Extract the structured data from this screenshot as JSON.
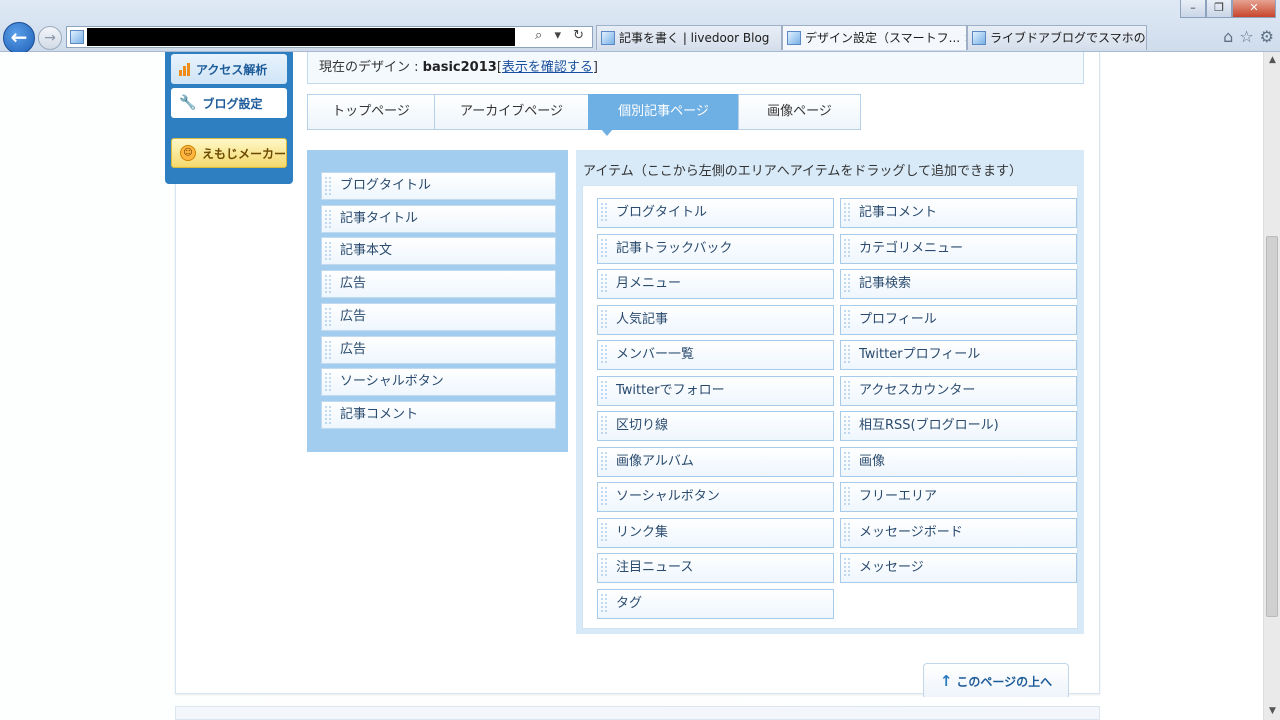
{
  "browser": {
    "tabs": [
      {
        "title": "記事を書く | livedoor Blog",
        "active": false,
        "closable": false
      },
      {
        "title": "デザイン設定（スマートフ...",
        "active": true,
        "closable": true
      },
      {
        "title": "ライブドアブログでスマホの...",
        "active": false,
        "closable": false
      }
    ],
    "address_tools": "⌕ ▾ ↻",
    "window_controls": {
      "minimize": "–",
      "maximize": "❐",
      "close": "✕"
    }
  },
  "sidebar": {
    "access": "アクセス解析",
    "blog_settings": "ブログ設定",
    "emoji_maker": "えもじメーカー"
  },
  "design_info": {
    "prefix": "現在のデザイン : ",
    "design_name": "basic2013",
    "link_open": "[",
    "link_text": "表示を確認する",
    "link_close": "]"
  },
  "page_tabs": [
    "トップページ",
    "アーカイブページ",
    "個別記事ページ",
    "画像ページ"
  ],
  "page_tabs_active": 2,
  "placed_items": [
    "ブログタイトル",
    "記事タイトル",
    "記事本文",
    "広告",
    "広告",
    "広告",
    "ソーシャルボタン",
    "記事コメント"
  ],
  "items_panel": {
    "title": "アイテム（ここから左側のエリアへアイテムをドラッグして追加できます）",
    "items": [
      "ブログタイトル",
      "記事コメント",
      "記事トラックバック",
      "カテゴリメニュー",
      "月メニュー",
      "記事検索",
      "人気記事",
      "プロフィール",
      "メンバー一覧",
      "Twitterプロフィール",
      "Twitterでフォロー",
      "アクセスカウンター",
      "区切り線",
      "相互RSS(ブログロール)",
      "画像アルバム",
      "画像",
      "ソーシャルボタン",
      "フリーエリア",
      "リンク集",
      "メッセージボード",
      "注目ニュース",
      "メッセージ",
      "タグ"
    ]
  },
  "back_to_top": "このページの上へ"
}
